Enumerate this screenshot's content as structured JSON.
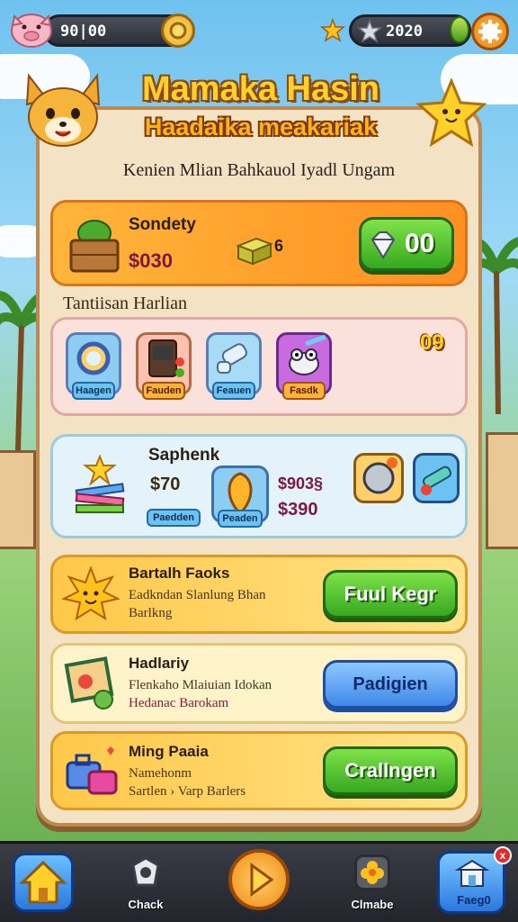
{
  "hud": {
    "coins": "90|00",
    "gems": "2020"
  },
  "header": {
    "title": "Mamaka Hasin",
    "subtitle": "Haadaika meakariak",
    "tagline": "Kenien Mlian Bahkauol Iyadl Ungam"
  },
  "offer": {
    "title": "Sondety",
    "price": "$030",
    "multiplier": "6",
    "amount": "00"
  },
  "daily": {
    "label": "Tantiisan Harlian",
    "count": "09",
    "items": [
      {
        "label": "Haagen",
        "style": "blue"
      },
      {
        "label": "Fauden",
        "style": "orange"
      },
      {
        "label": "Feauen",
        "style": "blue"
      },
      {
        "label": "Fasdk",
        "style": "orange"
      }
    ]
  },
  "shop": {
    "title": "Saphenk",
    "price_a": "$70",
    "price_b": "$903§",
    "price_c": "$390",
    "tag_a": "Paedden",
    "tag_b": "Peaden"
  },
  "tasks": [
    {
      "title": "Bartalh Faoks",
      "desc1": "Eadkndan Slanlung Bhan",
      "desc2": "Barlkng",
      "button": "Fuul Kegr",
      "style": "green",
      "icon": "sun-icon"
    },
    {
      "title": "Hadlariy",
      "desc1": "Flenkaho Mlaiuian Idokan",
      "desc2": "Hedanac Barokam",
      "button": "Padigien",
      "style": "blue",
      "icon": "picture-icon"
    },
    {
      "title": "Ming Paaia",
      "desc1": "Namehonm",
      "desc2": "Sartlen › Varp Barlers",
      "button": "Crallngen",
      "style": "green",
      "icon": "luggage-icon"
    }
  ],
  "nav": {
    "check": "Chack",
    "center": "Clmabe",
    "right": "Faeg0",
    "notification": "x"
  },
  "colors": {
    "accent_orange": "#ff8f22",
    "accent_green": "#36a820",
    "accent_blue": "#3f88e8",
    "panel": "#f3e2c3"
  }
}
